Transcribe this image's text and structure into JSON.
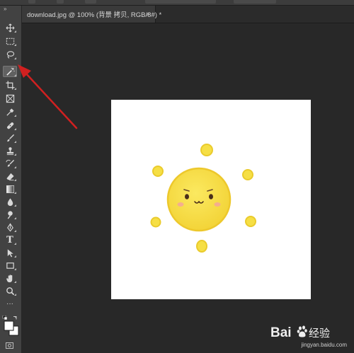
{
  "document_tab": {
    "title": "download.jpg @ 100% (背景 拷贝, RGB/8#) *",
    "close_glyph": "×"
  },
  "toolbar": {
    "collapse_glyph": "»",
    "tools": [
      {
        "name": "move-tool",
        "icon": "move-icon"
      },
      {
        "name": "marquee-tool",
        "icon": "rect-marquee-icon"
      },
      {
        "name": "lasso-tool",
        "icon": "lasso-icon"
      },
      {
        "name": "magic-wand-tool",
        "icon": "magic-wand-icon",
        "active": true
      },
      {
        "name": "crop-tool",
        "icon": "crop-icon"
      },
      {
        "name": "frame-tool",
        "icon": "frame-icon"
      },
      {
        "name": "eyedropper-tool",
        "icon": "eyedropper-icon"
      },
      {
        "name": "healing-brush-tool",
        "icon": "bandage-icon"
      },
      {
        "name": "brush-tool",
        "icon": "brush-icon"
      },
      {
        "name": "clone-stamp-tool",
        "icon": "stamp-icon"
      },
      {
        "name": "history-brush-tool",
        "icon": "history-brush-icon"
      },
      {
        "name": "eraser-tool",
        "icon": "eraser-icon"
      },
      {
        "name": "gradient-tool",
        "icon": "gradient-icon"
      },
      {
        "name": "blur-tool",
        "icon": "drop-icon"
      },
      {
        "name": "dodge-tool",
        "icon": "dodge-icon"
      },
      {
        "name": "pen-tool",
        "icon": "pen-icon"
      },
      {
        "name": "type-tool",
        "icon": "type-icon",
        "glyph": "T"
      },
      {
        "name": "path-selection-tool",
        "icon": "path-select-icon"
      },
      {
        "name": "rectangle-tool",
        "icon": "rectangle-icon"
      },
      {
        "name": "hand-tool",
        "icon": "hand-icon"
      },
      {
        "name": "zoom-tool",
        "icon": "zoom-icon"
      },
      {
        "name": "more-tools",
        "icon": "ellipsis-icon",
        "glyph": "···"
      }
    ],
    "foreground_color": "#ffffff",
    "background_color": "#ffffff"
  },
  "colors": {
    "workspace": "#282828",
    "panel": "#424242",
    "sun_fill": "#f8e34a",
    "sun_edge": "#ecc92a",
    "arrow": "#d02020"
  },
  "watermark": {
    "logo": "Bai",
    "logo_suffix": "经验",
    "subtext": "jingyan.baidu.com"
  }
}
